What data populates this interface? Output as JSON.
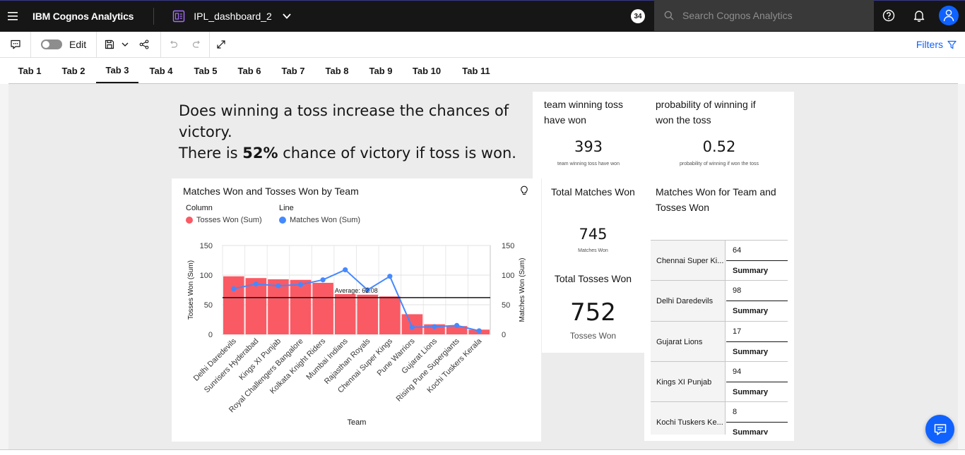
{
  "header": {
    "brand": "IBM Cognos Analytics",
    "dashboard_title": "IPL_dashboard_2",
    "badge": "34",
    "search_placeholder": "Search Cognos Analytics"
  },
  "toolbar": {
    "edit_label": "Edit",
    "filters_label": "Filters"
  },
  "tabs": [
    "Tab 1",
    "Tab 2",
    "Tab 3",
    "Tab 4",
    "Tab 5",
    "Tab 6",
    "Tab 7",
    "Tab 8",
    "Tab 9",
    "Tab 10",
    "Tab 11"
  ],
  "active_tab": "Tab 3",
  "headline": {
    "line1": "Does winning a toss increase the chances of victory.",
    "line2_prefix": "There is ",
    "line2_bold": "52%",
    "line2_suffix": " chance of victory if toss is won."
  },
  "kpis": {
    "toss_won": {
      "label": "team winning toss have won",
      "value": "393",
      "sub": "team winning toss have won"
    },
    "probability": {
      "label": "probability of winning if won the toss",
      "value": "0.52",
      "sub": "probability of winning if won the toss"
    },
    "total_matches": {
      "label": "Total Matches Won",
      "value": "745",
      "sub": "Matches Won"
    },
    "total_tosses": {
      "label": "Total Tosses Won",
      "value": "752",
      "sub": "Tosses Won"
    },
    "table_title": "Matches Won for Team and Tosses Won"
  },
  "table": {
    "summary_label": "Summary",
    "rows": [
      {
        "team": "Chennai Super Ki...",
        "value": "64"
      },
      {
        "team": "Delhi Daredevils",
        "value": "98"
      },
      {
        "team": "Gujarat Lions",
        "value": "17"
      },
      {
        "team": "Kings XI Punjab",
        "value": "94"
      },
      {
        "team": "Kochi Tuskers Ke...",
        "value": "8"
      }
    ]
  },
  "chart_data": {
    "type": "bar",
    "title": "Matches Won and Tosses Won by Team",
    "legend": {
      "column_heading": "Column",
      "line_heading": "Line",
      "column_series": "Tosses Won (Sum)",
      "line_series": "Matches Won (Sum)"
    },
    "xlabel": "Team",
    "ylabel": "Tosses Won (Sum)",
    "y2label": "Matches Won (Sum)",
    "ylim": [
      0,
      150
    ],
    "yticks": [
      "0",
      "50",
      "100",
      "150"
    ],
    "categories": [
      "Delhi Daredevils",
      "Sunrisers Hyderabad",
      "Kings XI Punjab",
      "Royal Challengers Bangalore",
      "Kolkata Knight Riders",
      "Mumbai Indians",
      "Rajasthan Royals",
      "Chennai Super Kings",
      "Pune Warriors",
      "Gujarat Lions",
      "Rising Pune Supergiants",
      "Kochi Tuskers Kerala"
    ],
    "series": [
      {
        "name": "Tosses Won (Sum)",
        "type": "bar",
        "color": "#fa5a64",
        "values": [
          98,
          95,
          93,
          92,
          87,
          68,
          67,
          64,
          34,
          17,
          14,
          8
        ]
      },
      {
        "name": "Matches Won (Sum)",
        "type": "line",
        "color": "#4589ff",
        "values": [
          77,
          85,
          82,
          84,
          92,
          109,
          75,
          98,
          12,
          13,
          15,
          6
        ]
      }
    ],
    "reference_line": {
      "label": "Average: 62.08",
      "value": 62.08
    }
  }
}
